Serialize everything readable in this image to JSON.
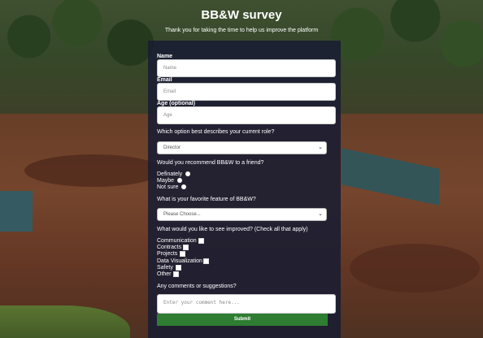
{
  "header": {
    "title": "BB&W survey",
    "subtitle": "Thank you for taking the time to help us improve the platform"
  },
  "form": {
    "name": {
      "label": "Name",
      "placeholder": "Name"
    },
    "email": {
      "label": "Email",
      "placeholder": "Email"
    },
    "age": {
      "label": "Age (optional)",
      "placeholder": "Age"
    },
    "role": {
      "question": "Which option best describes your current role?",
      "selected": "Director"
    },
    "recommend": {
      "question": "Would you recommend BB&W to a friend?",
      "options": [
        "Definately",
        "Maybe",
        "Not sure"
      ]
    },
    "feature": {
      "question": "What is your favorite feature of BB&W?",
      "selected": "Please Choose..."
    },
    "improve": {
      "question": "What would you like to see improved? (Check all that apply)",
      "options": [
        "Communication",
        "Contracts",
        "Projects",
        "Data Visualization",
        "Safety",
        "Other"
      ]
    },
    "comments": {
      "question": "Any comments or suggestions?",
      "placeholder": "Enter your comment here..."
    },
    "submit_label": "Submit"
  },
  "colors": {
    "panel": "#191c32",
    "submit": "#2e7d32"
  }
}
